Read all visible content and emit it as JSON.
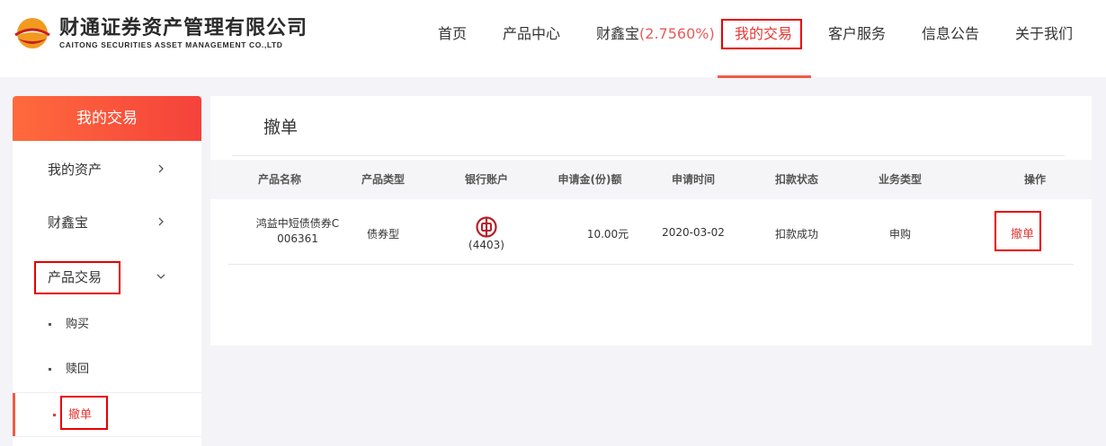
{
  "brand": {
    "name_cn": "财通证券资产管理有限公司",
    "name_en": "CAITONG SECURITIES ASSET MANAGEMENT CO.,LTD"
  },
  "nav": {
    "home": "首页",
    "products": "产品中心",
    "caixinbao": "财鑫宝",
    "caixinbao_rate": "(2.7560%)",
    "my_trades": "我的交易",
    "customer_service": "客户服务",
    "announcements": "信息公告",
    "about": "关于我们"
  },
  "sidebar": {
    "title": "我的交易",
    "items": {
      "assets": "我的资产",
      "caixinbao": "财鑫宝",
      "product_trade": "产品交易"
    },
    "sub_items": {
      "buy": "购买",
      "redeem": "赎回",
      "cancel": "撤单"
    }
  },
  "main": {
    "title": "撤单",
    "columns": {
      "product_name": "产品名称",
      "product_type": "产品类型",
      "bank_account": "银行账户",
      "amount": "申请金(份)额",
      "apply_time": "申请时间",
      "debit_status": "扣款状态",
      "business_type": "业务类型",
      "action": "操作"
    },
    "rows": [
      {
        "product_name_line1": "鸿益中短债债券C",
        "product_name_line2": "006361",
        "product_type": "债券型",
        "bank_account": "(4403)",
        "amount": "10.00元",
        "apply_time": "2020-03-02",
        "debit_status": "扣款成功",
        "business_type": "申购",
        "action": "撤单"
      }
    ]
  },
  "colors": {
    "accent": "#e53935",
    "highlight_box": "#e60000",
    "bank_icon": "#b5202a"
  }
}
